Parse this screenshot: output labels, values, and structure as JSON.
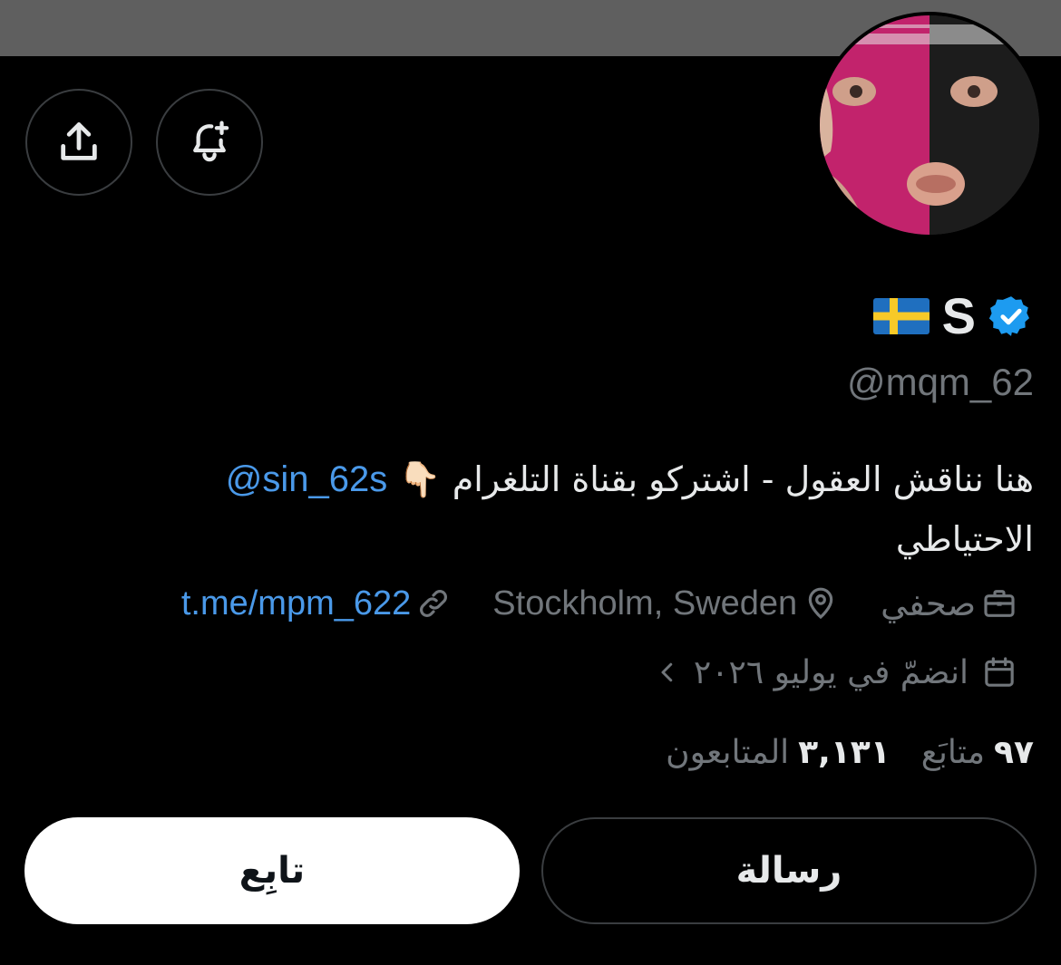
{
  "profile": {
    "display_name": "S",
    "flag_icon": "sweden-flag-icon",
    "verified_icon": "verified-badge-icon",
    "handle": "@mqm_62",
    "bio": {
      "text": "هنا نناقش العقول - اشتركو بقناة التلغرام 👇🏻 ",
      "mention": "@sin_62s",
      "text2": " الاحتياطي"
    },
    "meta": {
      "category": "صحفي",
      "location": "Stockholm, Sweden",
      "link": "t.me/mpm_622",
      "joined": "انضمّ في يوليو ٢٠٢٦"
    },
    "stats": {
      "following_count": "٩٧",
      "following_label": "متابَع",
      "followers_count": "٣,١٣١",
      "followers_label": "المتابعون"
    }
  },
  "actions": {
    "message_label": "رسالة",
    "follow_label": "تابِع",
    "share_icon": "share-icon",
    "notify_icon": "bell-plus-icon"
  },
  "colors": {
    "background": "#000000",
    "banner": "#5f5f5f",
    "link": "#4a99e9",
    "secondary_text": "#71767b",
    "verified": "#1d9bf0"
  }
}
